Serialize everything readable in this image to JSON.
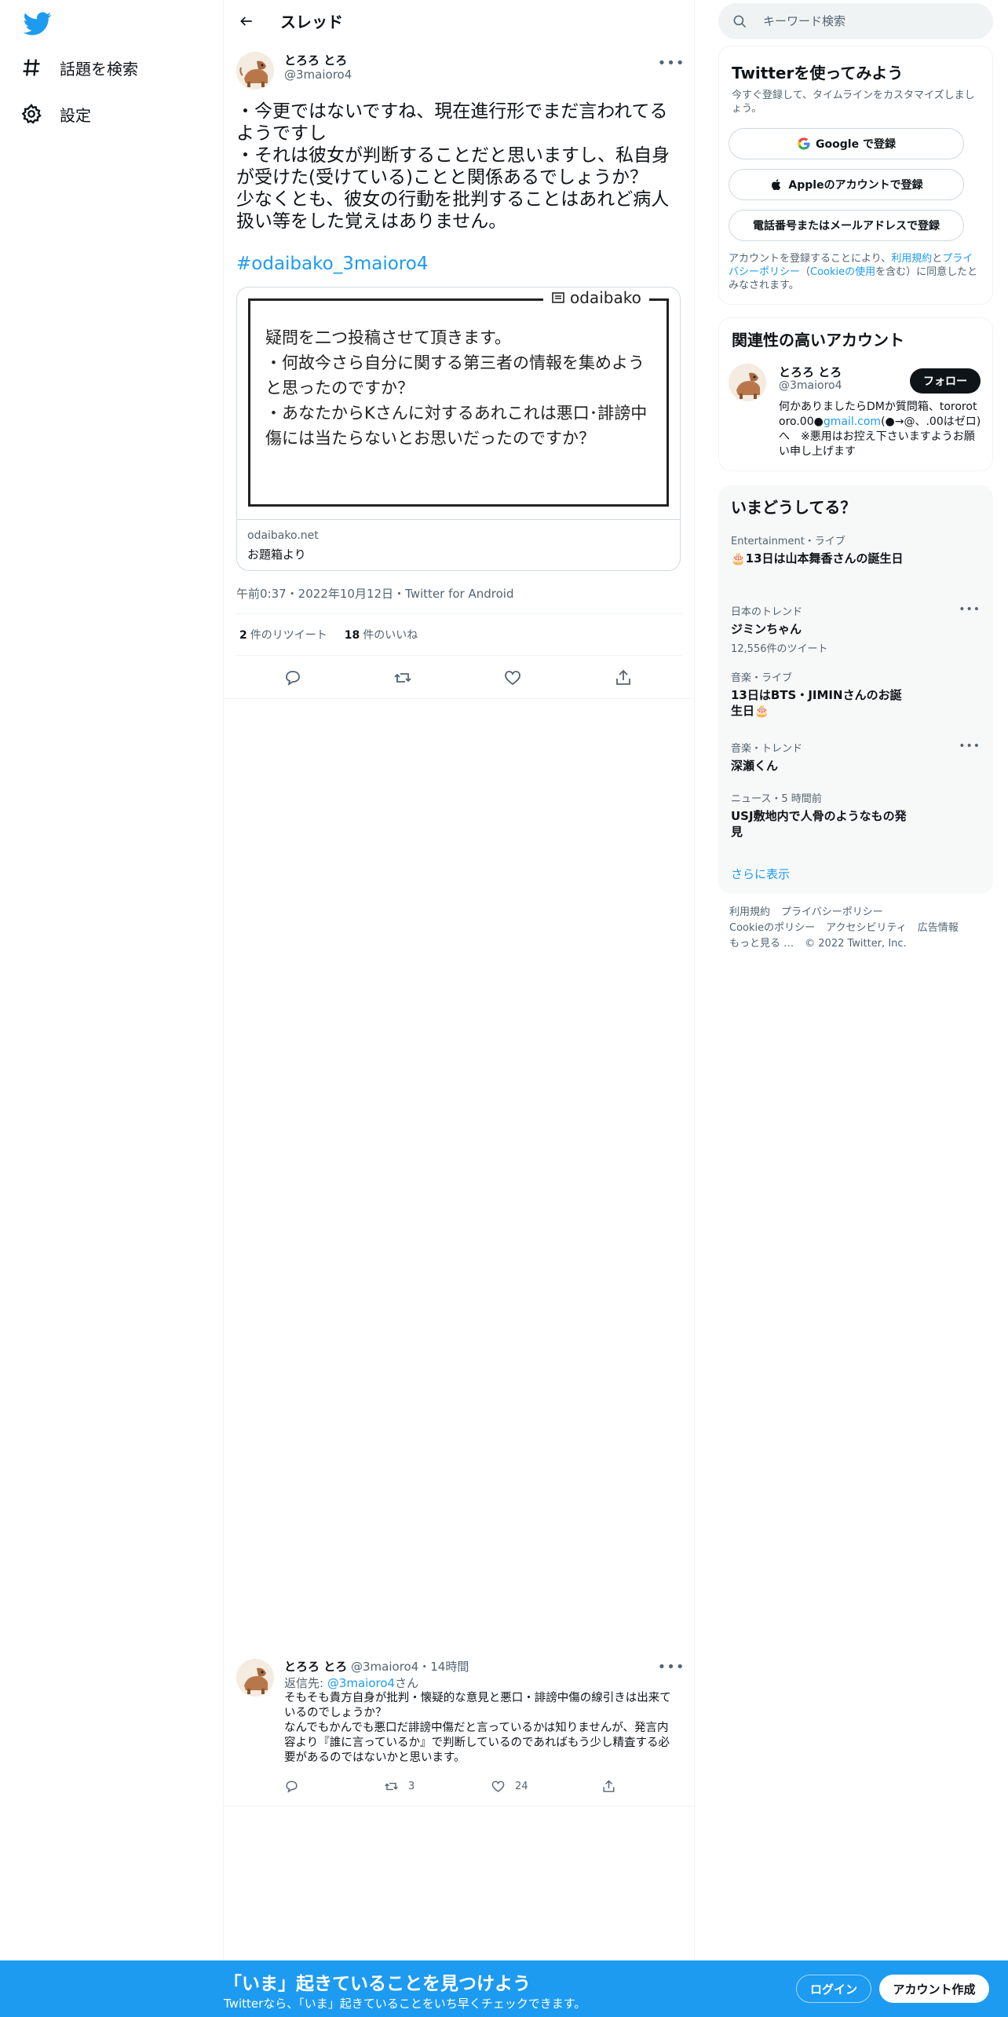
{
  "colors": {
    "accent": "#1d9bf0",
    "text": "#0f1419",
    "secondary": "#536471",
    "border": "#eff3f4"
  },
  "nav": {
    "items": [
      {
        "label": "話題を検索",
        "icon": "hash-icon"
      },
      {
        "label": "設定",
        "icon": "gear-icon"
      }
    ]
  },
  "thread": {
    "title": "スレッド",
    "tweet": {
      "name": "とろろ とろ",
      "handle": "@3maioro4",
      "text": "・今更ではないですね、現在進行形でまだ言われてるようですし\n・それは彼女が判断することだと思いますし、私自身が受けた(受けている)ことと関係あるでしょうか？\n少なくとも、彼女の行動を批判することはあれど病人扱い等をした覚えはありません。",
      "hashtag": "#odaibako_3maioro4",
      "card": {
        "brand": "odaibako",
        "body": "疑問を二つ投稿させて頂きます。\n・何故今さら自分に関する第三者の情報を集めようと思ったのですか？\n・あなたからKさんに対するあれこれは悪口･誹謗中傷には当たらないとお思いだったのですか？",
        "domain": "odaibako.net",
        "subtitle": "お題箱より"
      },
      "timestamp": "午前0:37・2022年10月12日・Twitter for Android",
      "retweets": "2",
      "retweets_label": "件のリツイート",
      "likes": "18",
      "likes_label": "件のいいね"
    },
    "reply": {
      "name": "とろろ とろ",
      "handle": "@3maioro4",
      "time": "・14時間",
      "replying_prefix": "返信先: ",
      "replying_to": "@3maioro4",
      "replying_suffix": "さん",
      "text": "そもそも貴方自身が批判・懐疑的な意見と悪口・誹謗中傷の線引きは出来ているのでしょうか？\nなんでもかんでも悪口だ誹謗中傷だと言っているかは知りませんが、発言内容より『誰に言っているか』で判断しているのであればもう少し精査する必要があるのではないかと思います。",
      "retweets": "3",
      "likes": "24"
    }
  },
  "sidebar": {
    "search_placeholder": "キーワード検索",
    "signup": {
      "title": "Twitterを使ってみよう",
      "desc": "今すぐ登録して、タイムラインをカスタマイズしましょう。",
      "google": "Google で登録",
      "apple": "Appleのアカウントで登録",
      "phone": "電話番号またはメールアドレスで登録",
      "legal_prefix": "アカウントを登録することにより、",
      "legal_terms": "利用規約",
      "legal_and": "と",
      "legal_privacy": "プライバシーポリシー",
      "legal_cookie_open": "（",
      "legal_cookie": "Cookieの使用",
      "legal_suffix": "を含む）に同意したとみなされます。"
    },
    "related": {
      "title": "関連性の高いアカウント",
      "name": "とろろ とろ",
      "handle": "@3maioro4",
      "follow": "フォロー",
      "bio_1": "何かありましたらDMか質問箱、tororotoro.00●",
      "bio_link": "gmail.com",
      "bio_2": "(●→@、.00はゼロ)へ　※悪用はお控え下さいますようお願い申し上げます"
    },
    "trends": {
      "title": "いまどうしてる？",
      "items": [
        {
          "context": "Entertainment・ライブ",
          "name": "🎂13日は山本舞香さんの誕生日",
          "count": "",
          "more": false
        },
        {
          "context": "日本のトレンド",
          "name": "ジミンちゃん",
          "count": "12,556件のツイート",
          "more": true
        },
        {
          "context": "音楽・ライブ",
          "name": "13日はBTS・JIMINさんのお誕生日🎂",
          "count": "",
          "more": false
        },
        {
          "context": "音楽・トレンド",
          "name": "深瀬くん",
          "count": "",
          "more": true
        },
        {
          "context": "ニュース・5 時間前",
          "name": "USJ敷地内で人骨のようなもの発見",
          "count": "",
          "more": false
        }
      ],
      "show_more": "さらに表示"
    },
    "footer": {
      "terms": "利用規約",
      "privacy": "プライバシーポリシー",
      "cookie": "Cookieのポリシー",
      "accessibility": "アクセシビリティ",
      "ads": "広告情報",
      "more": "もっと見る …",
      "copyright": "© 2022 Twitter, Inc."
    }
  },
  "bottom_bar": {
    "title": "「いま」起きていることを見つけよう",
    "subtitle": "Twitterなら、「いま」起きていることをいち早くチェックできます。",
    "login": "ログイン",
    "signup": "アカウント作成"
  }
}
